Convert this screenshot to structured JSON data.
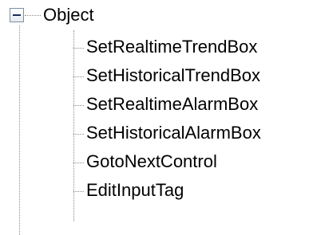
{
  "tree": {
    "root": {
      "label": "Object",
      "expanded": true,
      "expander_icon": "minus-box-icon"
    },
    "children": [
      {
        "label": "SetRealtimeTrendBox"
      },
      {
        "label": "SetHistoricalTrendBox"
      },
      {
        "label": "SetRealtimeAlarmBox"
      },
      {
        "label": "SetHistoricalAlarmBox"
      },
      {
        "label": "GotoNextControl"
      },
      {
        "label": "EditInputTag"
      }
    ]
  }
}
